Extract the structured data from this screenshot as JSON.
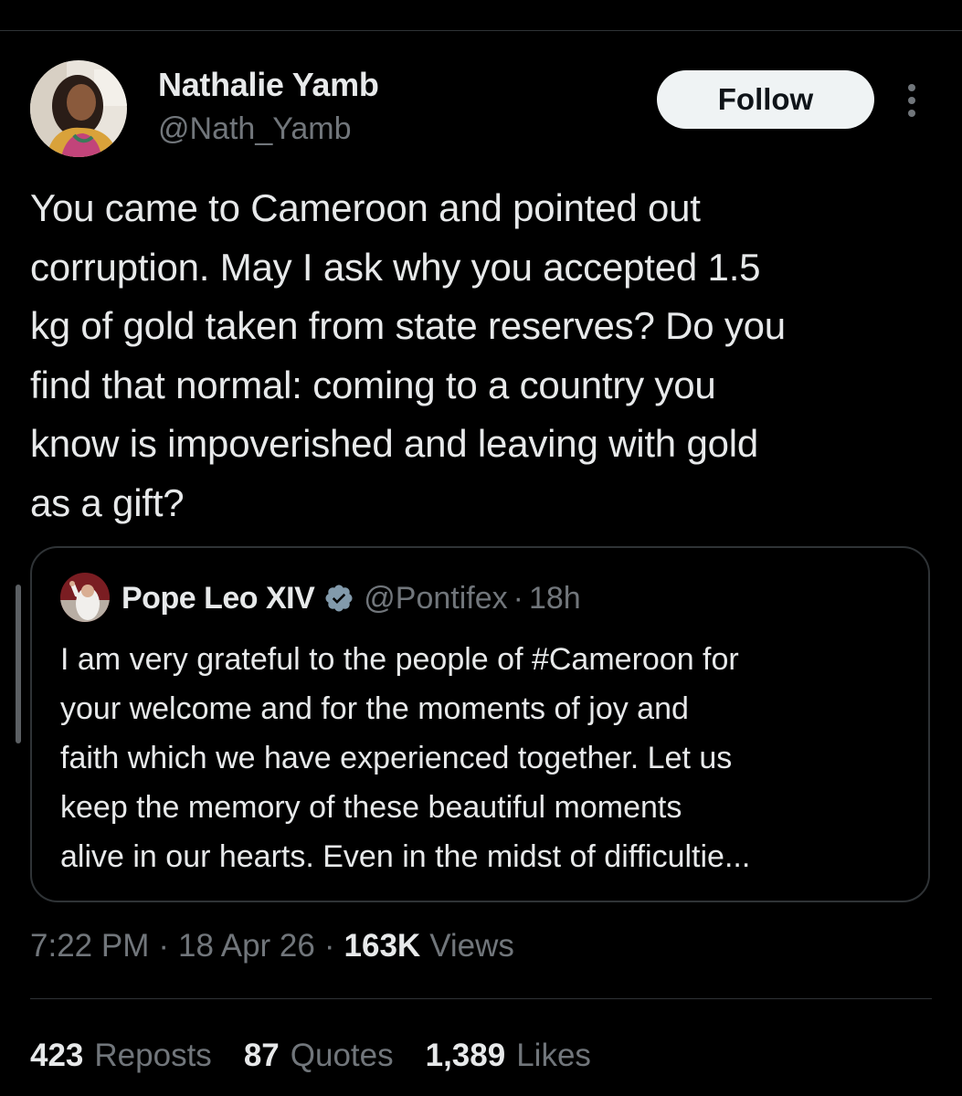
{
  "tweet": {
    "author_name": "Nathalie Yamb",
    "author_handle": "@Nath_Yamb",
    "follow_label": "Follow",
    "text": "You came to Cameroon and pointed out\ncorruption. May I ask why you accepted 1.5\nkg of gold taken from state reserves? Do you\nfind that normal: coming to a country you\nknow is impoverished and leaving with gold\nas a gift?",
    "time": "7:22 PM",
    "date": "18 Apr 26",
    "separator": "·",
    "views_count": "163K",
    "views_label": "Views"
  },
  "quote": {
    "author_name": "Pope Leo XIV",
    "author_handle": "@Pontifex",
    "separator": "·",
    "time": "18h",
    "text": "I am very grateful to the people of #Cameroon for\nyour welcome and for the moments of joy and\nfaith which we have experienced together. Let us\nkeep the memory of these beautiful moments\nalive in our hearts. Even in the midst of difficultie..."
  },
  "stats": {
    "reposts_count": "423",
    "reposts_label": "Reposts",
    "quotes_count": "87",
    "quotes_label": "Quotes",
    "likes_count": "1,389",
    "likes_label": "Likes"
  },
  "colors": {
    "background": "#000000",
    "text": "#e7e9ea",
    "secondary_text": "#71767b",
    "border": "#2f3336",
    "verified": "#829aab"
  },
  "icons": {
    "verified": "verified-badge-icon",
    "more": "more-vertical-icon"
  }
}
